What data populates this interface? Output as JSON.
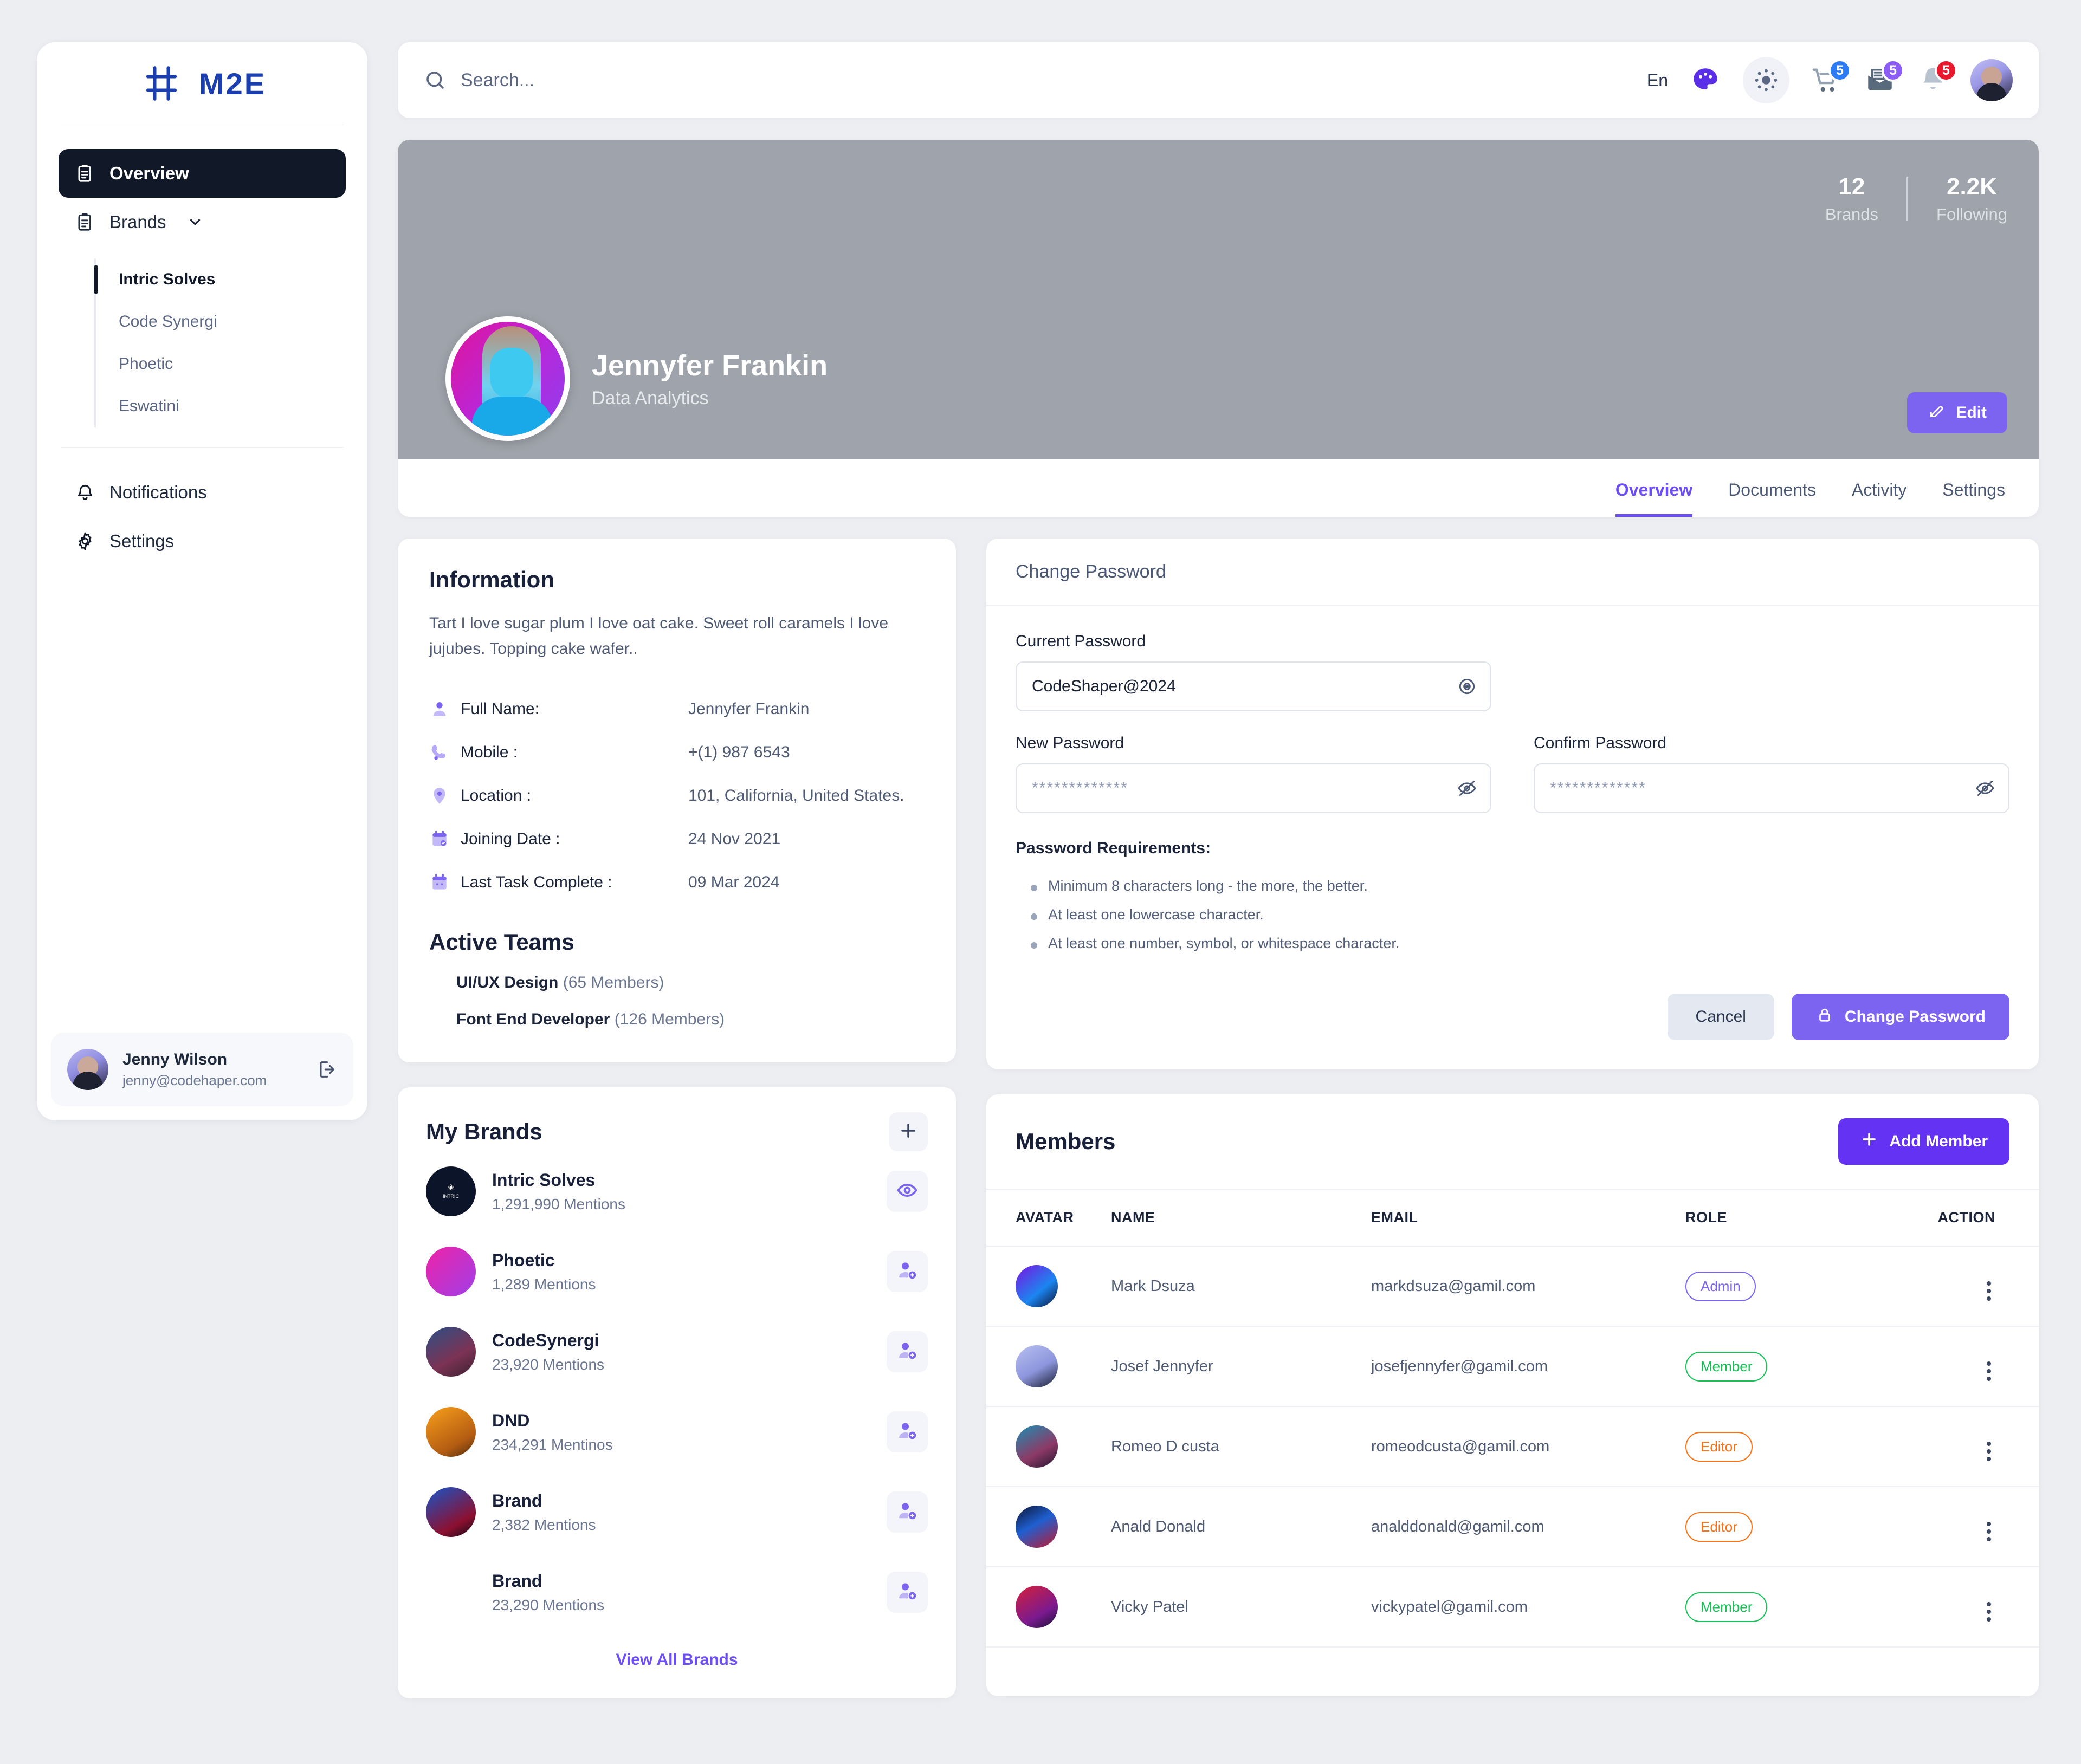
{
  "brand": {
    "logo_text": "M2E",
    "logo_icon": "m2e-logo-icon"
  },
  "sidebar": {
    "nav": [
      {
        "label": "Overview",
        "icon": "clipboard-icon",
        "active": true
      },
      {
        "label": "Brands",
        "icon": "clipboard-icon",
        "active": false,
        "expandable": true
      }
    ],
    "brands_sub": [
      {
        "label": "Intric Solves",
        "active": true
      },
      {
        "label": "Code Synergi",
        "active": false
      },
      {
        "label": "Phoetic",
        "active": false
      },
      {
        "label": "Eswatini",
        "active": false
      }
    ],
    "bottom_nav": [
      {
        "label": "Notifications",
        "icon": "bell-icon"
      },
      {
        "label": "Settings",
        "icon": "gear-icon"
      }
    ],
    "user": {
      "name": "Jenny Wilson",
      "email": "jenny@codehaper.com",
      "logout_icon": "logout-icon"
    }
  },
  "topbar": {
    "search_placeholder": "Search...",
    "search_value": "",
    "language": "En",
    "icons": [
      {
        "name": "palette-icon",
        "badge": null
      },
      {
        "name": "sun-icon",
        "badge": null
      },
      {
        "name": "cart-icon",
        "badge": "5",
        "badge_color": "#2b7cf5"
      },
      {
        "name": "mail-icon",
        "badge": "5",
        "badge_color": "#8b5cf6"
      },
      {
        "name": "bell-icon",
        "badge": "5",
        "badge_color": "#e8192c"
      }
    ],
    "avatar": "user-avatar"
  },
  "profile": {
    "name": "Jennyfer Frankin",
    "role": "Data Analytics",
    "edit_label": "Edit",
    "stats": [
      {
        "value": "12",
        "label": "Brands"
      },
      {
        "value": "2.2K",
        "label": "Following"
      }
    ],
    "tabs": [
      {
        "label": "Overview",
        "active": true
      },
      {
        "label": "Documents",
        "active": false
      },
      {
        "label": "Activity",
        "active": false
      },
      {
        "label": "Settings",
        "active": false
      }
    ]
  },
  "information": {
    "title": "Information",
    "description": "Tart I love sugar plum I love oat cake. Sweet roll caramels I love jujubes. Topping cake wafer..",
    "rows": [
      {
        "icon": "person-icon",
        "label": "Full Name:",
        "value": "Jennyfer Frankin"
      },
      {
        "icon": "phone-icon",
        "label": "Mobile :",
        "value": "+(1) 987 6543"
      },
      {
        "icon": "location-pin-icon",
        "label": "Location :",
        "value": "101, California, United States."
      },
      {
        "icon": "calendar-check-icon",
        "label": "Joining Date :",
        "value": "24 Nov 2021"
      },
      {
        "icon": "calendar-icon",
        "label": "Last Task Complete :",
        "value": "09 Mar 2024"
      }
    ],
    "teams_title": "Active Teams",
    "teams": [
      {
        "name": "UI/UX Design",
        "count": "(65 Members)"
      },
      {
        "name": "Font End Developer",
        "count": "(126 Members)"
      }
    ]
  },
  "change_password": {
    "title": "Change Password",
    "current_label": "Current Password",
    "current_value": "CodeShaper@2024",
    "current_placeholder": "Current Password",
    "new_label": "New Password",
    "new_value": "",
    "new_placeholder": "*************",
    "confirm_label": "Confirm Password",
    "confirm_value": "",
    "confirm_placeholder": "*************",
    "requirements_title": "Password Requirements:",
    "requirements": [
      "Minimum 8 characters long - the more, the better.",
      "At least one lowercase character.",
      "At least one number, symbol, or whitespace character."
    ],
    "cancel_label": "Cancel",
    "submit_label": "Change Password"
  },
  "my_brands": {
    "title": "My Brands",
    "add_icon": "plus-icon",
    "view_all_label": "View All Brands",
    "items": [
      {
        "name": "Intric Solves",
        "mentions": "1,291,990 Mentions",
        "action_icon": "eye-icon",
        "avatar": "intric-solves-logo"
      },
      {
        "name": "Phoetic",
        "mentions": "1,289 Mentions",
        "action_icon": "add-person-icon",
        "avatar": "phoetic-avatar"
      },
      {
        "name": "CodeSynergi",
        "mentions": "23,920 Mentions",
        "action_icon": "add-person-icon",
        "avatar": "codesynergi-avatar"
      },
      {
        "name": "DND",
        "mentions": "234,291 Mentinos",
        "action_icon": "add-person-icon",
        "avatar": "dnd-avatar"
      },
      {
        "name": "Brand",
        "mentions": "2,382 Mentions",
        "action_icon": "add-person-icon",
        "avatar": "brand-avatar"
      },
      {
        "name": "Brand",
        "mentions": "23,290 Mentions",
        "action_icon": "add-person-icon",
        "avatar": "none"
      }
    ]
  },
  "members": {
    "title": "Members",
    "add_label": "Add Member",
    "columns": [
      "AVATAR",
      "NAME",
      "EMAIL",
      "ROLE",
      "ACTION"
    ],
    "rows": [
      {
        "name": "Mark Dsuza",
        "email": "markdsuza@gamil.com",
        "role": "Admin",
        "role_color": "#7c63f0",
        "avatar": "mark-dsuza-avatar"
      },
      {
        "name": "Josef Jennyfer",
        "email": "josefjennyfer@gamil.com",
        "role": "Member",
        "role_color": "#16c156",
        "avatar": "josef-jennyfer-avatar"
      },
      {
        "name": "Romeo D custa",
        "email": "romeodcusta@gamil.com",
        "role": "Editor",
        "role_color": "#f97316",
        "avatar": "romeo-dcusta-avatar"
      },
      {
        "name": "Anald Donald",
        "email": "analddonald@gamil.com",
        "role": "Editor",
        "role_color": "#f97316",
        "avatar": "anald-donald-avatar"
      },
      {
        "name": "Vicky Patel",
        "email": "vickypatel@gamil.com",
        "role": "Member",
        "role_color": "#16c156",
        "avatar": "vicky-patel-avatar"
      }
    ]
  },
  "theme": {
    "accent": "#7c63f0",
    "accent_strong": "#6432f2",
    "dark": "#111827"
  }
}
